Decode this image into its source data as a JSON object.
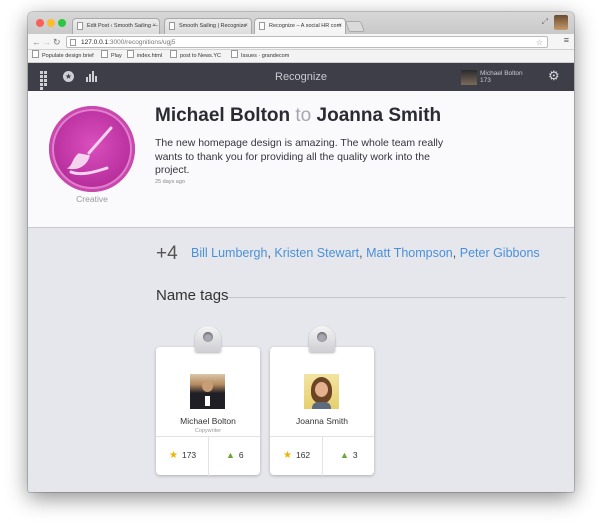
{
  "browser": {
    "tabs": [
      {
        "label": "Edit Post ‹ Smooth Sailing —"
      },
      {
        "label": "Smooth Sailing | Recognize"
      },
      {
        "label": "Recognize – A social HR com"
      }
    ],
    "url_host": "127.0.0.1",
    "url_path": ":3000/recognitions/ugj5",
    "bookmarks": [
      "Populate design brief",
      "Play",
      "index.html",
      "post to News.YC",
      "Issues · grandecom"
    ]
  },
  "app": {
    "title": "Recognize",
    "user_name": "Michael Bolton",
    "user_points": "173"
  },
  "recognition": {
    "sender": "Michael Bolton",
    "connector": "to",
    "recipient": "Joanna Smith",
    "message": "The new homepage design is amazing. The whole team really wants to thank you for providing all the quality work into the project.",
    "time_ago": "25 days ago",
    "badge_name": "Creative",
    "badge_color": "#b52c9b"
  },
  "others": {
    "count": "+4",
    "names": [
      "Bill Lumbergh",
      "Kristen Stewart",
      "Matt Thompson",
      "Peter Gibbons"
    ],
    "separator": ","
  },
  "name_tags": {
    "title": "Name tags",
    "cards": [
      {
        "name": "Michael Bolton",
        "role": "Copywriter",
        "points": "173",
        "recognitions": "6"
      },
      {
        "name": "Joanna Smith",
        "role": "",
        "points": "162",
        "recognitions": "3"
      }
    ]
  }
}
